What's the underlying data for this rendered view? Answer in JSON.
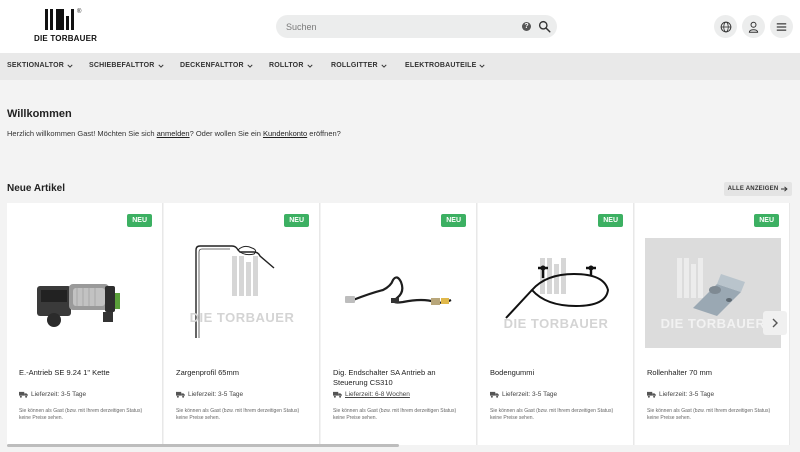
{
  "header": {
    "logo_text": "DIE TORBAUER",
    "search_placeholder": "Suchen",
    "icons": [
      "globe-icon",
      "user-icon",
      "menu-icon",
      "search-icon",
      "help-icon"
    ]
  },
  "nav": {
    "items": [
      {
        "label": "SEKTIONALTOR"
      },
      {
        "label": "SCHIEBEFALTTOR"
      },
      {
        "label": "DECKENFALTTOR"
      },
      {
        "label": "ROLLTOR"
      },
      {
        "label": "ROLLGITTER"
      },
      {
        "label": "ELEKTROBAUTEILE"
      }
    ]
  },
  "welcome": {
    "title": "Willkommen",
    "text_1": "Herzlich willkommen Gast! Möchten Sie sich ",
    "link_login": "anmelden",
    "text_2": "? Oder wollen Sie ein ",
    "link_account": "Kundenkonto",
    "text_3": " eröffnen?"
  },
  "new_articles": {
    "title": "Neue Artikel",
    "show_all": "ALLE ANZEIGEN",
    "badge": "NEU",
    "watermark": "DIE TORBAUER",
    "products": [
      {
        "name": "E.-Antrieb SE 9.24 1\" Kette",
        "delivery": "Lieferzeit: 3-5 Tage",
        "note": "Sie können als Gast (bzw. mit Ihrem derzeitigen Status) keine Preise sehen."
      },
      {
        "name": "Zargenprofil 65mm",
        "delivery": "Lieferzeit: 3-5 Tage",
        "note": "Sie können als Gast (bzw. mit Ihrem derzeitigen Status) keine Preise sehen."
      },
      {
        "name": "Dig. Endschalter SA Antrieb an Steuerung CS310",
        "delivery": "Lieferzeit: 6-8 Wochen",
        "note": "Sie können als Gast (bzw. mit Ihrem derzeitigen Status) keine Preise sehen."
      },
      {
        "name": "Bodengummi",
        "delivery": "Lieferzeit: 3-5 Tage",
        "note": "Sie können als Gast (bzw. mit Ihrem derzeitigen Status) keine Preise sehen."
      },
      {
        "name": "Rollenhalter 70 mm",
        "delivery": "Lieferzeit: 3-5 Tage",
        "note": "Sie können als Gast (bzw. mit Ihrem derzeitigen Status) keine Preise sehen."
      }
    ]
  },
  "colors": {
    "badge_green": "#3cb062",
    "nav_bg": "#e9e9e9",
    "page_bg": "#f3f3f3"
  }
}
